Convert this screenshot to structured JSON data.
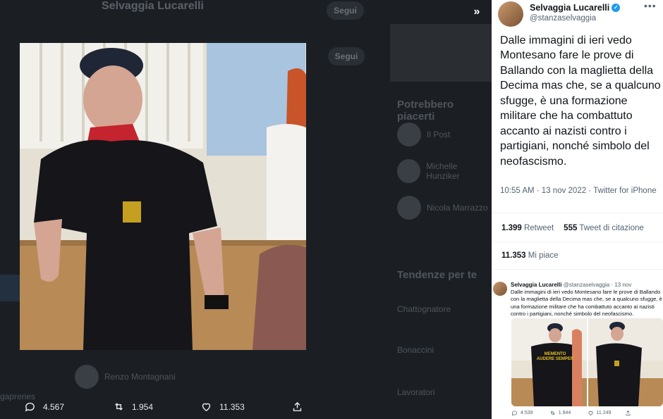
{
  "background": {
    "profile_name": "Selvaggia Lucarelli",
    "follow_label": "Segui",
    "follow_label_2": "Segui",
    "suggestions_heading": "Potrebbero piacerti",
    "suggestion_1": "Il Post",
    "suggestion_2": "Michelle Hunziker",
    "suggestion_3": "Nicola Marrazzo",
    "trends_heading": "Tendenze per te",
    "trend_1": "Chattognatore",
    "trend_2": "Bonaccini",
    "trend_3": "Lavoratori",
    "reply_user": "Renzo Montagnani",
    "left_fragment": "gaprenes"
  },
  "viewer_actions": {
    "replies": "4.567",
    "retweets": "1.954",
    "likes": "11.353"
  },
  "tweet": {
    "author_name": "Selvaggia Lucarelli",
    "author_handle": "@stanzaselvaggia",
    "text": "Dalle immagini di ieri vedo Montesano fare le prove di Ballando con la maglietta della Decima mas che, se a qualcuno sfugge, è una formazione militare che ha combattuto accanto ai nazisti contro i partigiani, nonché simbolo del neofascismo.",
    "timestamp": "10:55 AM · 13 nov 2022 · Twitter for iPhone",
    "retweets_count": "1.399",
    "retweets_label": "Retweet",
    "quotes_count": "555",
    "quotes_label": "Tweet di citazione",
    "likes_count": "11.353",
    "likes_label": "Mi piace"
  },
  "embed": {
    "name": "Selvaggia Lucarelli",
    "handle": "@stanzaselvaggia · 13 nov",
    "text": "Dalle immagini di ieri vedo Montesano fare le prove di Ballando con la maglietta della Decima mas che, se a qualcuno sfugge, è una formazione militare che ha combattuto accanto ai nazisti contro i partigiani, nonché simbolo del neofascismo.",
    "shirt_text": "MEMENTO AUDERE SEMPER",
    "replies": "4.539",
    "retweets": "1.944",
    "likes": "11.249"
  },
  "colors": {
    "accent": "#1d9bf0",
    "panel_bg": "#ffffff",
    "overlay_bg": "#15181c"
  },
  "icons": [
    "expand-icon",
    "reply-icon",
    "retweet-icon",
    "like-icon",
    "share-icon",
    "verified-icon",
    "more-icon"
  ]
}
